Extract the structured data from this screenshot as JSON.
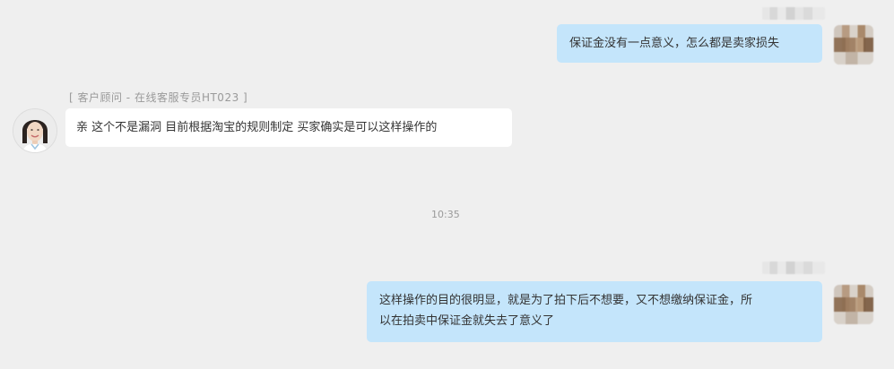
{
  "messages": [
    {
      "id": "m1",
      "side": "right",
      "text": "保证金没有一点意义，怎么都是卖家损失"
    },
    {
      "id": "m2",
      "side": "left",
      "sender_label": "[ 客户顾问  -  在线客服专员HT023 ]",
      "text": "亲 这个不是漏洞 目前根据淘宝的规则制定 买家确实是可以这样操作的"
    },
    {
      "id": "m3",
      "side": "right",
      "lines": [
        "这样操作的目的很明显，就是为了拍下后不想要，又不想缴纳保证金，所",
        "以在拍卖中保证金就失去了意义了"
      ]
    }
  ],
  "timestamp": "10:35",
  "colors": {
    "background": "#efefef",
    "my_bubble": "#c4e5fb",
    "other_bubble": "#ffffff",
    "meta_text": "#9a9a9a"
  }
}
